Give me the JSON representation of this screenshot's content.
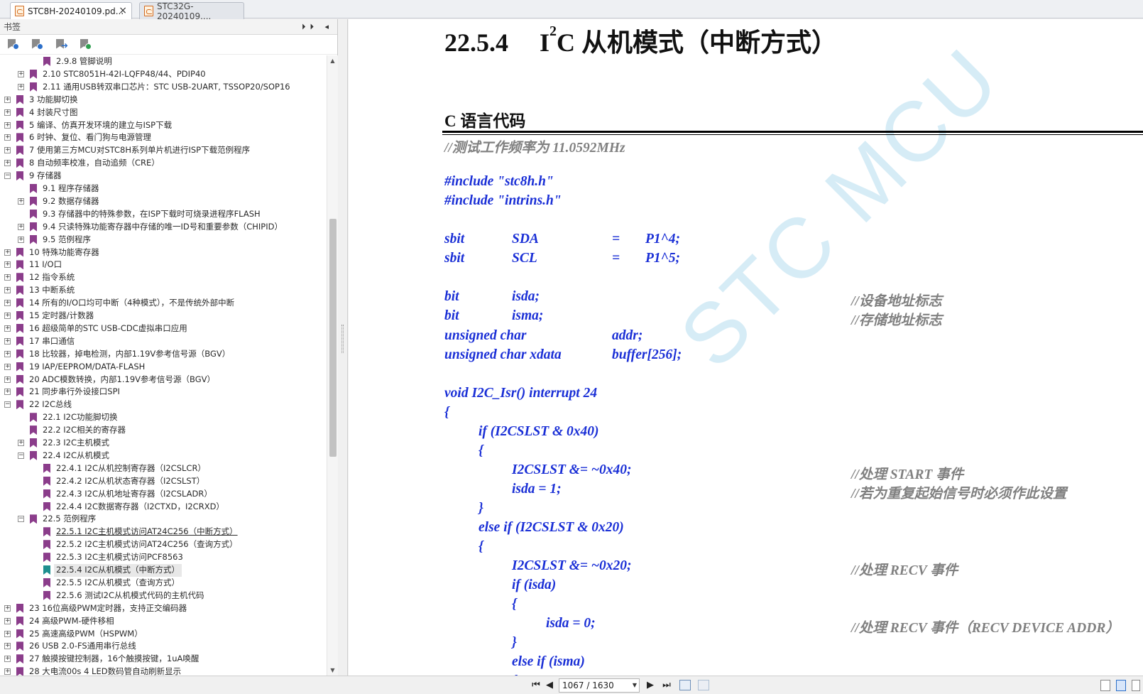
{
  "tabs": [
    {
      "label": "STC8H-20240109.pd...",
      "active": true,
      "close": "×"
    },
    {
      "label": "STC32G-20240109....",
      "active": false
    }
  ],
  "sidebar": {
    "title": "书签",
    "header_buttons": "⏵⏵ ◂",
    "toolbar_icons": [
      "bookmark-expand-icon",
      "bookmark-collapse-icon",
      "bookmark-goto-icon",
      "bookmark-find-icon"
    ],
    "tree": [
      {
        "label": "2.9.8  管脚说明",
        "level": 2,
        "exp": null
      },
      {
        "label": "2.10  STC8051H-42I-LQFP48/44、PDIP40",
        "level": 1,
        "exp": "+"
      },
      {
        "label": "2.11  通用USB转双串口芯片：STC USB-2UART, TSSOP20/SOP16",
        "level": 1,
        "exp": "+"
      },
      {
        "label": "3  功能脚切换",
        "level": 0,
        "exp": "+"
      },
      {
        "label": "4  封装尺寸图",
        "level": 0,
        "exp": "+"
      },
      {
        "label": "5  编译、仿真开发环境的建立与ISP下载",
        "level": 0,
        "exp": "+"
      },
      {
        "label": "6  时钟、复位、看门狗与电源管理",
        "level": 0,
        "exp": "+"
      },
      {
        "label": "7  使用第三方MCU对STC8H系列单片机进行ISP下载范例程序",
        "level": 0,
        "exp": "+"
      },
      {
        "label": "8  自动频率校准，自动追频（CRE）",
        "level": 0,
        "exp": "+"
      },
      {
        "label": "9  存储器",
        "level": 0,
        "exp": "-"
      },
      {
        "label": "9.1 程序存储器",
        "level": 1,
        "exp": null
      },
      {
        "label": "9.2  数据存储器",
        "level": 1,
        "exp": "+"
      },
      {
        "label": "9.3  存储器中的特殊参数，在ISP下载时可烧录进程序FLASH",
        "level": 1,
        "exp": null
      },
      {
        "label": "9.4  只读特殊功能寄存器中存储的唯一ID号和重要参数（CHIPID）",
        "level": 1,
        "exp": "+"
      },
      {
        "label": "9.5  范例程序",
        "level": 1,
        "exp": "+"
      },
      {
        "label": "10  特殊功能寄存器",
        "level": 0,
        "exp": "+"
      },
      {
        "label": "11  I/O口",
        "level": 0,
        "exp": "+"
      },
      {
        "label": "12  指令系统",
        "level": 0,
        "exp": "+"
      },
      {
        "label": "13  中断系统",
        "level": 0,
        "exp": "+"
      },
      {
        "label": "14  所有的I/O口均可中断（4种模式），不是传统外部中断",
        "level": 0,
        "exp": "+"
      },
      {
        "label": "15  定时器/计数器",
        "level": 0,
        "exp": "+"
      },
      {
        "label": "16  超级简单的STC USB-CDC虚拟串口应用",
        "level": 0,
        "exp": "+"
      },
      {
        "label": "17  串口通信",
        "level": 0,
        "exp": "+"
      },
      {
        "label": "18  比较器，掉电检测，内部1.19V参考信号源（BGV）",
        "level": 0,
        "exp": "+"
      },
      {
        "label": "19  IAP/EEPROM/DATA-FLASH",
        "level": 0,
        "exp": "+"
      },
      {
        "label": "20  ADC模数转换，内部1.19V参考信号源（BGV）",
        "level": 0,
        "exp": "+"
      },
      {
        "label": "21  同步串行外设接口SPI",
        "level": 0,
        "exp": "+"
      },
      {
        "label": "22  I2C总线",
        "level": 0,
        "exp": "-"
      },
      {
        "label": "22.1 I2C功能脚切换",
        "level": 1,
        "exp": null
      },
      {
        "label": "22.2 I2C相关的寄存器",
        "level": 1,
        "exp": null
      },
      {
        "label": "22.3  I2C主机模式",
        "level": 1,
        "exp": "+"
      },
      {
        "label": "22.4  I2C从机模式",
        "level": 1,
        "exp": "-"
      },
      {
        "label": "22.4.1 I2C从机控制寄存器（I2CSLCR）",
        "level": 2,
        "exp": null
      },
      {
        "label": "22.4.2 I2C从机状态寄存器（I2CSLST）",
        "level": 2,
        "exp": null
      },
      {
        "label": "22.4.3  I2C从机地址寄存器（I2CSLADR）",
        "level": 2,
        "exp": null
      },
      {
        "label": "22.4.4  I2C数据寄存器（I2CTXD，I2CRXD）",
        "level": 2,
        "exp": null
      },
      {
        "label": "22.5  范例程序",
        "level": 1,
        "exp": "-"
      },
      {
        "label": "22.5.1 I2C主机模式访问AT24C256（中断方式）",
        "level": 2,
        "exp": null,
        "underlined": true
      },
      {
        "label": "22.5.2 I2C主机模式访问AT24C256（查询方式）",
        "level": 2,
        "exp": null
      },
      {
        "label": "22.5.3 I2C主机模式访问PCF8563",
        "level": 2,
        "exp": null
      },
      {
        "label": "22.5.4 I2C从机模式（中断方式）",
        "level": 2,
        "exp": null,
        "selected": true
      },
      {
        "label": "22.5.5 I2C从机模式（查询方式）",
        "level": 2,
        "exp": null
      },
      {
        "label": "22.5.6 测试I2C从机模式代码的主机代码",
        "level": 2,
        "exp": null
      },
      {
        "label": "23  16位高级PWM定时器，支持正交编码器",
        "level": 0,
        "exp": "+"
      },
      {
        "label": "24  高级PWM-硬件移相",
        "level": 0,
        "exp": "+"
      },
      {
        "label": "25  高速高级PWM（HSPWM）",
        "level": 0,
        "exp": "+"
      },
      {
        "label": "26  USB 2.0-FS通用串行总线",
        "level": 0,
        "exp": "+"
      },
      {
        "label": "27  触摸按键控制器，16个触摸按键，1uA唤醒",
        "level": 0,
        "exp": "+"
      },
      {
        "label": "28  大电流00s 4 LED数码管自动刷新显示",
        "level": 0,
        "exp": "+"
      }
    ]
  },
  "document": {
    "section_number": "22.5.4",
    "section_title_pre": "I",
    "section_title_sup": "2",
    "section_title_post": "C 从机模式（中断方式）",
    "subtitle": "C 语言代码",
    "watermark": "STC MCU",
    "code": [
      [
        {
          "t": "//测试工作频率为 11.0592MHz",
          "c": true,
          "col": 0
        }
      ],
      [],
      [
        {
          "t": "#include \"stc8h.h\"",
          "col": 0
        }
      ],
      [
        {
          "t": "#include \"intrins.h\"",
          "col": 0
        }
      ],
      [],
      [
        {
          "t": "sbit",
          "col": 0
        },
        {
          "t": "SDA",
          "col": 2
        },
        {
          "t": "=",
          "col": 5
        },
        {
          "t": "P1^4;",
          "col": 6
        }
      ],
      [
        {
          "t": "sbit",
          "col": 0
        },
        {
          "t": "SCL",
          "col": 2
        },
        {
          "t": "=",
          "col": 5
        },
        {
          "t": "P1^5;",
          "col": 6
        }
      ],
      [],
      [
        {
          "t": "bit",
          "col": 0
        },
        {
          "t": "isda;",
          "col": 2
        },
        {
          "t": "//设备地址标志",
          "c": true,
          "col": 12
        }
      ],
      [
        {
          "t": "bit",
          "col": 0
        },
        {
          "t": "isma;",
          "col": 2
        },
        {
          "t": "//存储地址标志",
          "c": true,
          "col": 12
        }
      ],
      [
        {
          "t": "unsigned char",
          "col": 0
        },
        {
          "t": "addr;",
          "col": 5
        }
      ],
      [
        {
          "t": "unsigned char xdata",
          "col": 0
        },
        {
          "t": "buffer[256];",
          "col": 5
        }
      ],
      [],
      [
        {
          "t": "void I2C_Isr() interrupt 24",
          "col": 0
        }
      ],
      [
        {
          "t": "{",
          "col": 0
        }
      ],
      [
        {
          "t": "if (I2CSLST & 0x40)",
          "col": 1
        }
      ],
      [
        {
          "t": "{",
          "col": 1
        }
      ],
      [
        {
          "t": "I2CSLST &= ~0x40;",
          "col": 2
        },
        {
          "t": "//处理 START 事件",
          "c": true,
          "col": 12
        }
      ],
      [
        {
          "t": "isda = 1;",
          "col": 2
        },
        {
          "t": "//若为重复起始信号时必须作此设置",
          "c": true,
          "col": 12
        }
      ],
      [
        {
          "t": "}",
          "col": 1
        }
      ],
      [
        {
          "t": "else if (I2CSLST & 0x20)",
          "col": 1
        }
      ],
      [
        {
          "t": "{",
          "col": 1
        }
      ],
      [
        {
          "t": "I2CSLST &= ~0x20;",
          "col": 2
        },
        {
          "t": "//处理 RECV 事件",
          "c": true,
          "col": 12
        }
      ],
      [
        {
          "t": "if (isda)",
          "col": 2
        }
      ],
      [
        {
          "t": "{",
          "col": 2
        }
      ],
      [
        {
          "t": "isda = 0;",
          "col": 3
        },
        {
          "t": "//处理 RECV 事件（RECV DEVICE ADDR）",
          "c": true,
          "col": 12
        }
      ],
      [
        {
          "t": "}",
          "col": 2
        }
      ],
      [
        {
          "t": "else if (isma)",
          "col": 2
        }
      ],
      [
        {
          "t": "{",
          "col": 2
        }
      ]
    ]
  },
  "statusbar": {
    "page_indicator": "1067 / 1630"
  }
}
